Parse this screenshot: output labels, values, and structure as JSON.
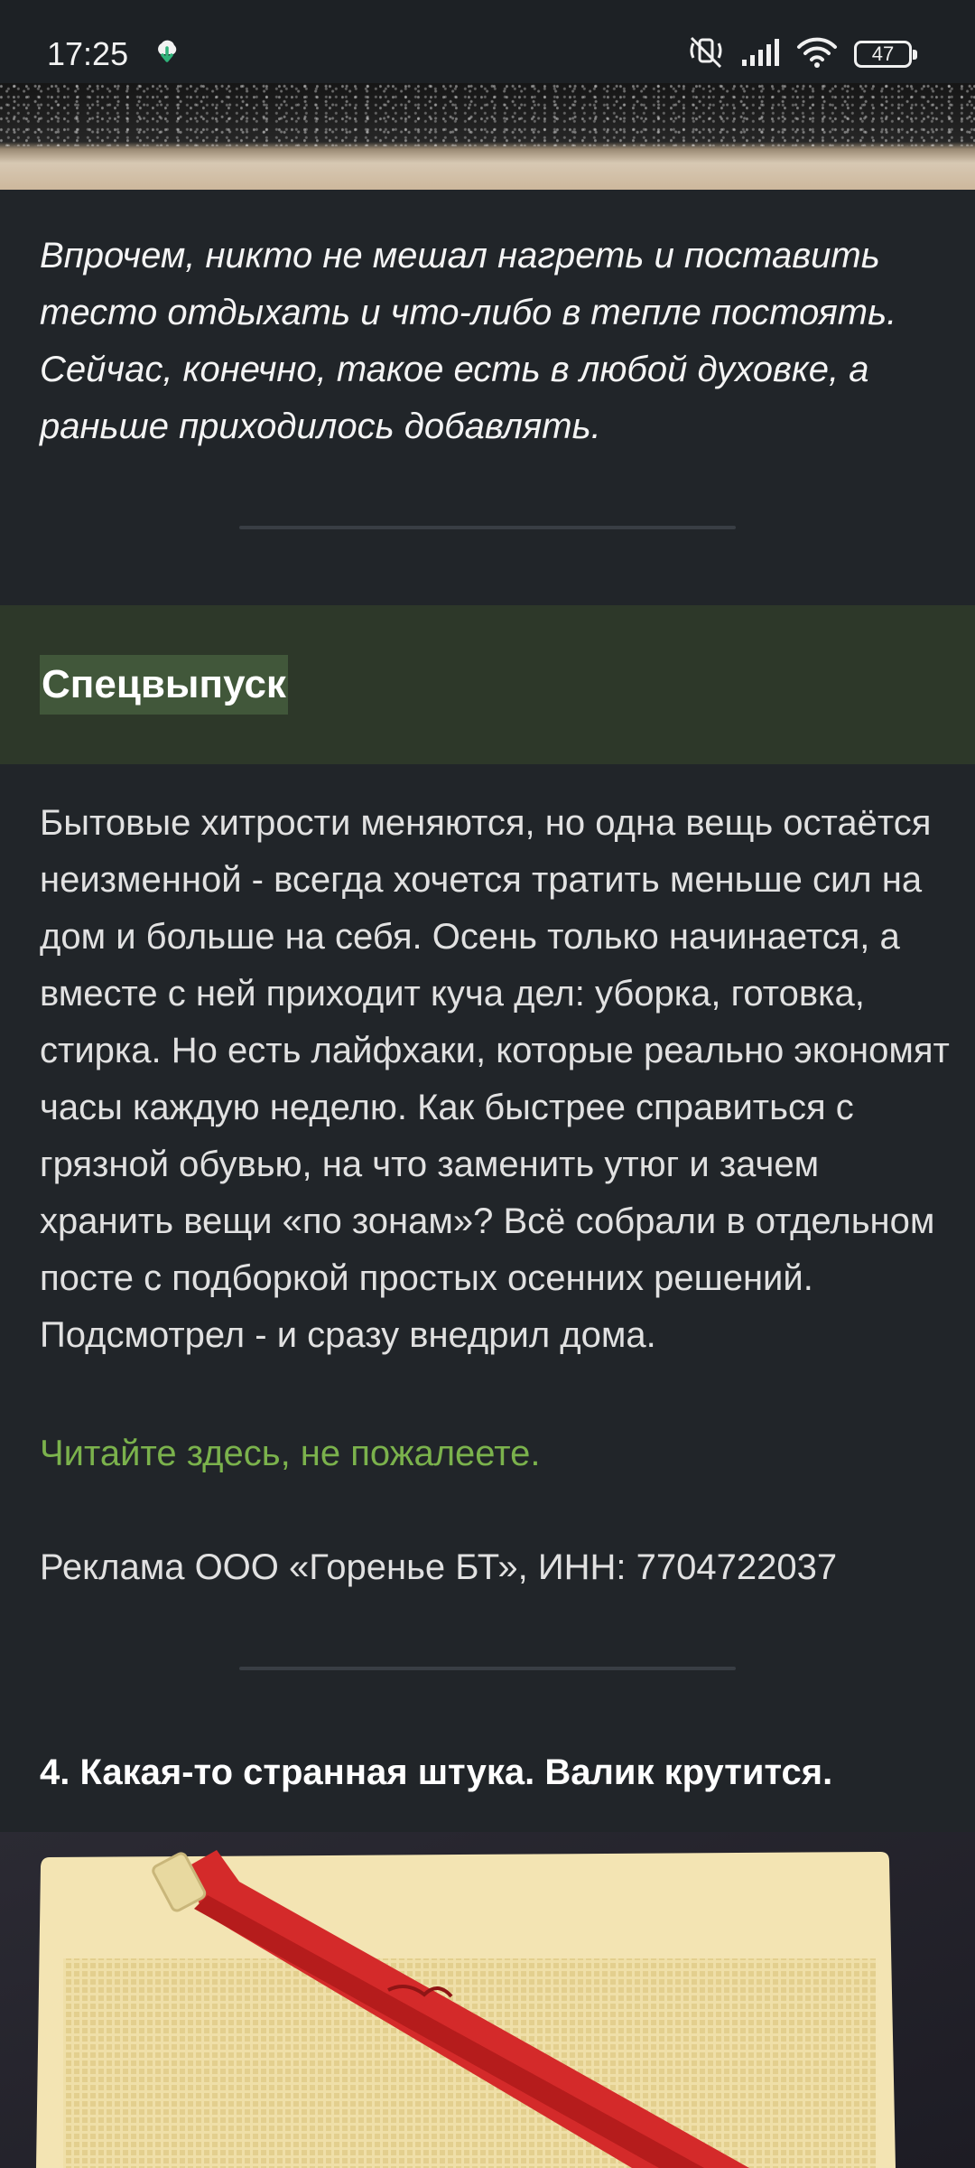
{
  "status_bar": {
    "time": "17:25",
    "battery_level": "47",
    "icons": [
      "cloud-upload-icon",
      "mute-icon",
      "signal-icon",
      "wifi-icon",
      "battery-icon"
    ]
  },
  "article": {
    "italic_paragraph": "Впрочем, никто не мешал нагреть и поставить тесто отдыхать и что-либо в тепле постоять. Сейчас, конечно, такое есть в любой духовке, а раньше приходилось добавлять.",
    "special": {
      "title": "Спецвыпуск",
      "body": "Бытовые хитрости меняются, но одна вещь остаётся неизменной - всегда хочется тратить меньше сил на дом и больше на себя.  Осень только начинается, а вместе с ней приходит куча дел: уборка, готовка, стирка. Но есть лайфхаки, которые реально экономят часы каждую неделю. Как быстрее справиться с грязной обувью, на что заменить утюг и зачем хранить вещи «по зонам»? Всё собрали в отдельном посте с подборкой простых осенних решений. Подсмотрел - и сразу внедрил дома.",
      "link": "Читайте здесь, не пожалеете.",
      "ad_note": "Реклама ООО «Горенье БТ», ИНН: 7704722037"
    },
    "section_heading": "4. Какая-то странная штука. Валик крутится."
  },
  "colors": {
    "background": "#212529",
    "banner": "#2d3829",
    "title_highlight": "#41573a",
    "link": "#7bb24c",
    "divider": "#393e44"
  }
}
